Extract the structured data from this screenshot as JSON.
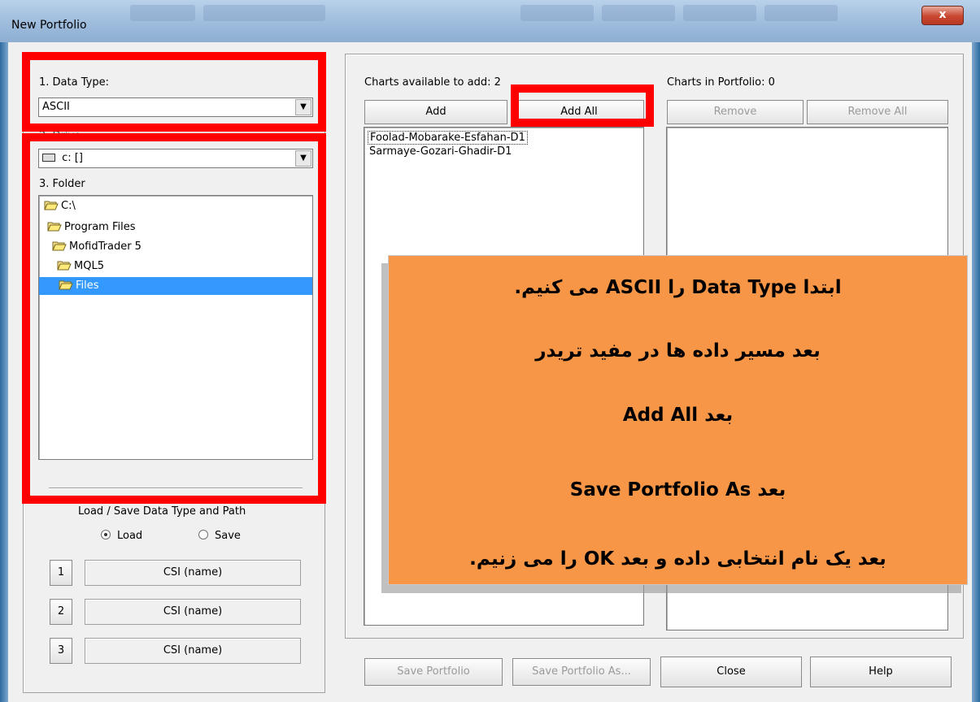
{
  "window": {
    "title": "New Portfolio",
    "close_label": "x"
  },
  "data_type": {
    "label": "1. Data Type:",
    "value": "ASCII"
  },
  "drive": {
    "label": "2. Drive",
    "value": "c: []"
  },
  "folder": {
    "label": "3. Folder",
    "items": [
      {
        "name": "C:\\"
      },
      {
        "name": "Program Files"
      },
      {
        "name": "MofidTrader 5"
      },
      {
        "name": "MQL5"
      },
      {
        "name": "Files"
      }
    ],
    "selected": "Files"
  },
  "load_save": {
    "label": "Load / Save Data Type and Path",
    "load_label": "Load",
    "save_label": "Save",
    "selected": "Load",
    "slots": [
      {
        "num": "1",
        "name": "CSI (name)"
      },
      {
        "num": "2",
        "name": "CSI (name)"
      },
      {
        "num": "3",
        "name": "CSI (name)"
      }
    ]
  },
  "available": {
    "label": "Charts available to add: 2",
    "add_label": "Add",
    "add_all_label": "Add All",
    "items": [
      "Foolad-Mobarake-Esfahan-D1",
      "Sarmaye-Gozari-Ghadir-D1"
    ]
  },
  "portfolio": {
    "label": "Charts in Portfolio: 0",
    "remove_label": "Remove",
    "remove_all_label": "Remove All"
  },
  "footer": {
    "save_portfolio": "Save Portfolio",
    "save_portfolio_as": "Save Portfolio As...",
    "close": "Close",
    "help": "Help"
  },
  "instructions": {
    "line1": "ابتدا  Data Type را ASCII می کنیم.",
    "line2": "بعد مسیر داده ها در مفید تریدر",
    "line3": "بعد Add All",
    "line4": "بعد Save Portfolio As",
    "line5": "بعد یک نام انتخابی داده و بعد OK  را می زنیم."
  },
  "colors": {
    "highlight": "#ff0000",
    "overlay": "#f79646",
    "selection": "#3399ff"
  }
}
